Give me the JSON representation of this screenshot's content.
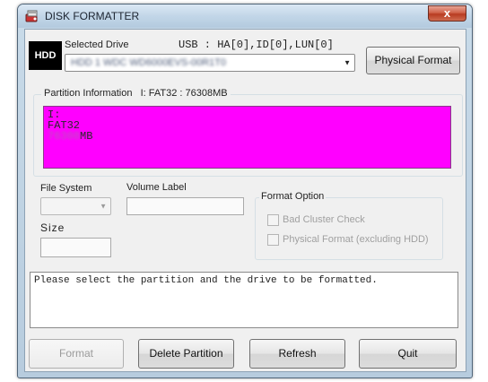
{
  "window": {
    "title": "DISK FORMATTER",
    "close_glyph": "x"
  },
  "drive": {
    "badge": "HDD",
    "selected_label": "Selected Drive",
    "usb_info": "USB : HA[0],ID[0],LUN[0]",
    "combo_value": "HDD 1 WDC WD6000EVS-00R1T0",
    "physical_format_button": "Physical Format"
  },
  "partition": {
    "group_label": "Partition Information",
    "summary": "I: FAT32 : 76308MB",
    "lines": [
      "I:",
      "FAT32"
    ],
    "size_hidden": "76308",
    "size_unit": "MB"
  },
  "fields": {
    "file_system_label": "File System",
    "volume_label_label": "Volume Label",
    "size_label": "Size",
    "file_system_value": "",
    "volume_label_value": "",
    "size_value": ""
  },
  "format_option": {
    "group_label": "Format Option",
    "bad_cluster": "Bad Cluster Check",
    "physical_format": "Physical Format (excluding HDD)"
  },
  "status": {
    "message": "Please select the partition and the drive to be formatted."
  },
  "buttons": {
    "format": "Format",
    "delete_partition": "Delete Partition",
    "refresh": "Refresh",
    "quit": "Quit"
  },
  "icons": {
    "app": "disk-formatter-icon",
    "close": "close-icon",
    "dropdown": "chevron-down-icon",
    "checkbox": "checkbox-icon"
  }
}
